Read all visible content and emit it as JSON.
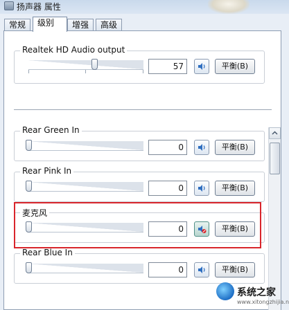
{
  "window": {
    "title": "扬声器 属性"
  },
  "tabs": [
    {
      "label": "常规",
      "active": false
    },
    {
      "label": "级别",
      "active": true
    },
    {
      "label": "增强",
      "active": false
    },
    {
      "label": "高级",
      "active": false
    }
  ],
  "master": {
    "label": "Realtek HD Audio output",
    "value": "57",
    "level_percent": 57,
    "balance_label": "平衡(B)",
    "muted": false
  },
  "devices": [
    {
      "label": "Rear Green In",
      "value": "0",
      "level_percent": 0,
      "balance_label": "平衡(B)",
      "muted": false
    },
    {
      "label": "Rear Pink In",
      "value": "0",
      "level_percent": 0,
      "balance_label": "平衡(B)",
      "muted": false
    },
    {
      "label": "麦克风",
      "value": "0",
      "level_percent": 0,
      "balance_label": "平衡(B)",
      "muted": true
    },
    {
      "label": "Rear Blue In",
      "value": "0",
      "level_percent": 0,
      "balance_label": "平衡(B)",
      "muted": false
    }
  ],
  "watermark": {
    "text": "系统之家",
    "sub": "www.xitongzhijia.net"
  },
  "colors": {
    "highlight": "#d9252b",
    "speaker_icon": "#2f6fc0"
  }
}
